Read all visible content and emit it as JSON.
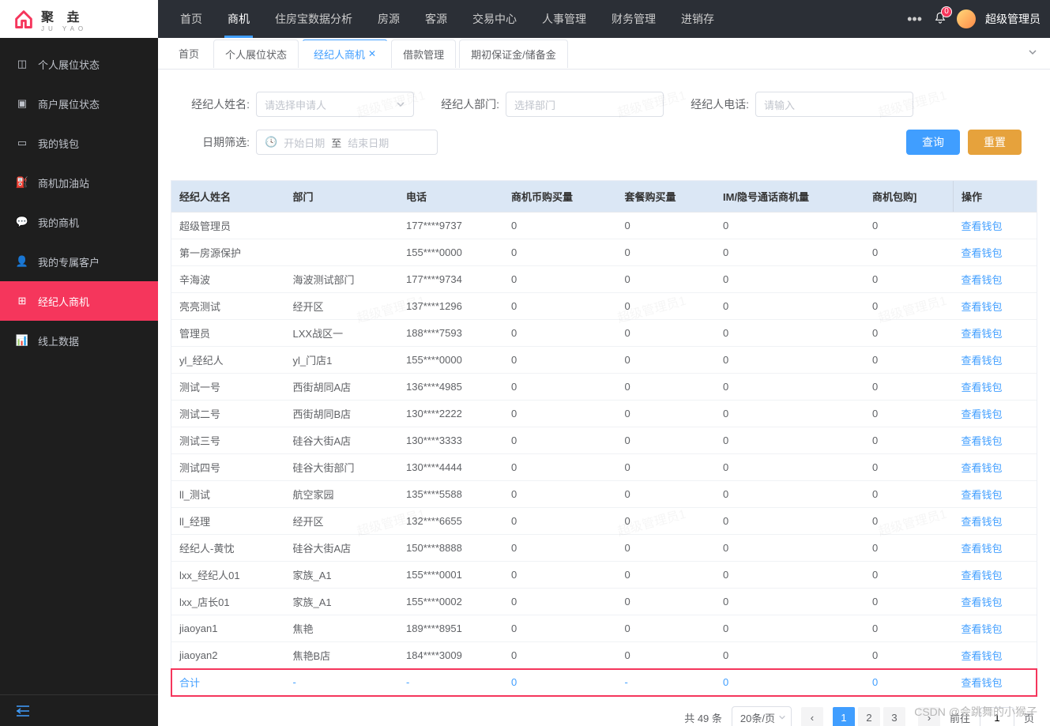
{
  "brand": {
    "main": "聚 垚",
    "sub": "JU YAO"
  },
  "sidebar": {
    "items": [
      {
        "label": "个人展位状态",
        "icon": "user-card"
      },
      {
        "label": "商户展位状态",
        "icon": "store"
      },
      {
        "label": "我的钱包",
        "icon": "wallet"
      },
      {
        "label": "商机加油站",
        "icon": "station"
      },
      {
        "label": "我的商机",
        "icon": "chat"
      },
      {
        "label": "我的专属客户",
        "icon": "client"
      },
      {
        "label": "经纪人商机",
        "icon": "agent",
        "active": true
      },
      {
        "label": "线上数据",
        "icon": "chart"
      }
    ]
  },
  "topnav": {
    "items": [
      "首页",
      "商机",
      "住房宝数据分析",
      "房源",
      "客源",
      "交易中心",
      "人事管理",
      "财务管理",
      "进销存"
    ],
    "activeIndex": 1,
    "more": "•••",
    "badge": "0",
    "username": "超级管理员"
  },
  "tabs": {
    "items": [
      {
        "label": "首页"
      },
      {
        "label": "个人展位状态"
      },
      {
        "label": "经纪人商机",
        "active": true,
        "closable": true
      },
      {
        "label": "借款管理"
      },
      {
        "label": "期初保证金/储备金"
      }
    ]
  },
  "filters": {
    "agentName": {
      "label": "经纪人姓名:",
      "placeholder": "请选择申请人"
    },
    "agentDept": {
      "label": "经纪人部门:",
      "placeholder": "选择部门"
    },
    "agentPhone": {
      "label": "经纪人电话:",
      "placeholder": "请输入"
    },
    "dateFilter": {
      "label": "日期筛选:",
      "start": "开始日期",
      "sep": "至",
      "end": "结束日期",
      "icon": "🕓"
    },
    "searchBtn": "查询",
    "resetBtn": "重置"
  },
  "table": {
    "headers": [
      "经纪人姓名",
      "部门",
      "电话",
      "商机币购买量",
      "套餐购买量",
      "IM/隐号通话商机量",
      "商机包购]",
      "操作"
    ],
    "actionLabel": "查看钱包",
    "rows": [
      {
        "name": "超级管理员",
        "dept": "",
        "phone": "177****9737",
        "c1": "0",
        "c2": "0",
        "c3": "0",
        "c4": "0"
      },
      {
        "name": "第一房源保护",
        "dept": "",
        "phone": "155****0000",
        "c1": "0",
        "c2": "0",
        "c3": "0",
        "c4": "0"
      },
      {
        "name": "辛海波",
        "dept": "海波测试部门",
        "phone": "177****9734",
        "c1": "0",
        "c2": "0",
        "c3": "0",
        "c4": "0"
      },
      {
        "name": "亮亮测试",
        "dept": "经开区",
        "phone": "137****1296",
        "c1": "0",
        "c2": "0",
        "c3": "0",
        "c4": "0"
      },
      {
        "name": "管理员",
        "dept": "LXX战区一",
        "phone": "188****7593",
        "c1": "0",
        "c2": "0",
        "c3": "0",
        "c4": "0"
      },
      {
        "name": "yl_经纪人",
        "dept": "yl_门店1",
        "phone": "155****0000",
        "c1": "0",
        "c2": "0",
        "c3": "0",
        "c4": "0"
      },
      {
        "name": "测试一号",
        "dept": "西街胡同A店",
        "phone": "136****4985",
        "c1": "0",
        "c2": "0",
        "c3": "0",
        "c4": "0"
      },
      {
        "name": "测试二号",
        "dept": "西街胡同B店",
        "phone": "130****2222",
        "c1": "0",
        "c2": "0",
        "c3": "0",
        "c4": "0"
      },
      {
        "name": "测试三号",
        "dept": "硅谷大街A店",
        "phone": "130****3333",
        "c1": "0",
        "c2": "0",
        "c3": "0",
        "c4": "0"
      },
      {
        "name": "测试四号",
        "dept": "硅谷大街部门",
        "phone": "130****4444",
        "c1": "0",
        "c2": "0",
        "c3": "0",
        "c4": "0"
      },
      {
        "name": "ll_测试",
        "dept": "航空家园",
        "phone": "135****5588",
        "c1": "0",
        "c2": "0",
        "c3": "0",
        "c4": "0"
      },
      {
        "name": "ll_经理",
        "dept": "经开区",
        "phone": "132****6655",
        "c1": "0",
        "c2": "0",
        "c3": "0",
        "c4": "0"
      },
      {
        "name": "经纪人-黄忱",
        "dept": "硅谷大街A店",
        "phone": "150****8888",
        "c1": "0",
        "c2": "0",
        "c3": "0",
        "c4": "0"
      },
      {
        "name": "lxx_经纪人01",
        "dept": "家族_A1",
        "phone": "155****0001",
        "c1": "0",
        "c2": "0",
        "c3": "0",
        "c4": "0"
      },
      {
        "name": "lxx_店长01",
        "dept": "家族_A1",
        "phone": "155****0002",
        "c1": "0",
        "c2": "0",
        "c3": "0",
        "c4": "0"
      },
      {
        "name": "jiaoyan1",
        "dept": "焦艳",
        "phone": "189****8951",
        "c1": "0",
        "c2": "0",
        "c3": "0",
        "c4": "0"
      },
      {
        "name": "jiaoyan2",
        "dept": "焦艳B店",
        "phone": "184****3009",
        "c1": "0",
        "c2": "0",
        "c3": "0",
        "c4": "0"
      }
    ],
    "sumRow": {
      "name": "合计",
      "dept": "-",
      "phone": "-",
      "c1": "0",
      "c2": "-",
      "c3": "0",
      "c4": "0"
    }
  },
  "pagination": {
    "total": "共 49 条",
    "pageSize": "20条/页",
    "pages": [
      "1",
      "2",
      "3"
    ],
    "current": 0,
    "gotoLabel": "前往",
    "gotoValue": "1",
    "pageSuffix": "页"
  },
  "watermark": "超级管理员1",
  "attribution": "CSDN @会跳舞的小猴子"
}
